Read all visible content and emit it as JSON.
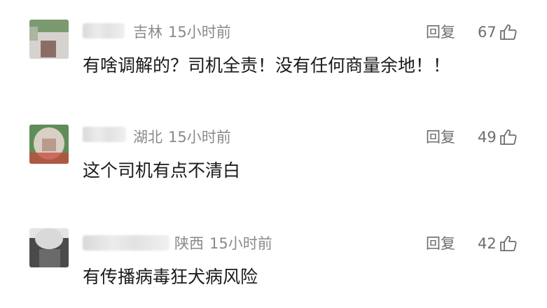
{
  "comments": [
    {
      "region": "吉林",
      "time": "15小时前",
      "reply_label": "回复",
      "like_count": "67",
      "content": "有啥调解的？司机全责！没有任何商量余地！！"
    },
    {
      "region": "湖北",
      "time": "15小时前",
      "reply_label": "回复",
      "like_count": "49",
      "content": "这个司机有点不清白"
    },
    {
      "region": "陕西",
      "time": "15小时前",
      "reply_label": "回复",
      "like_count": "42",
      "content": "有传播病毒狂犬病风险"
    }
  ],
  "icons": {
    "like": "thumbs-up-icon"
  },
  "colors": {
    "meta_text": "#8a8a8a",
    "action_text": "#6e6e6e",
    "content_text": "#1a1a1a"
  }
}
